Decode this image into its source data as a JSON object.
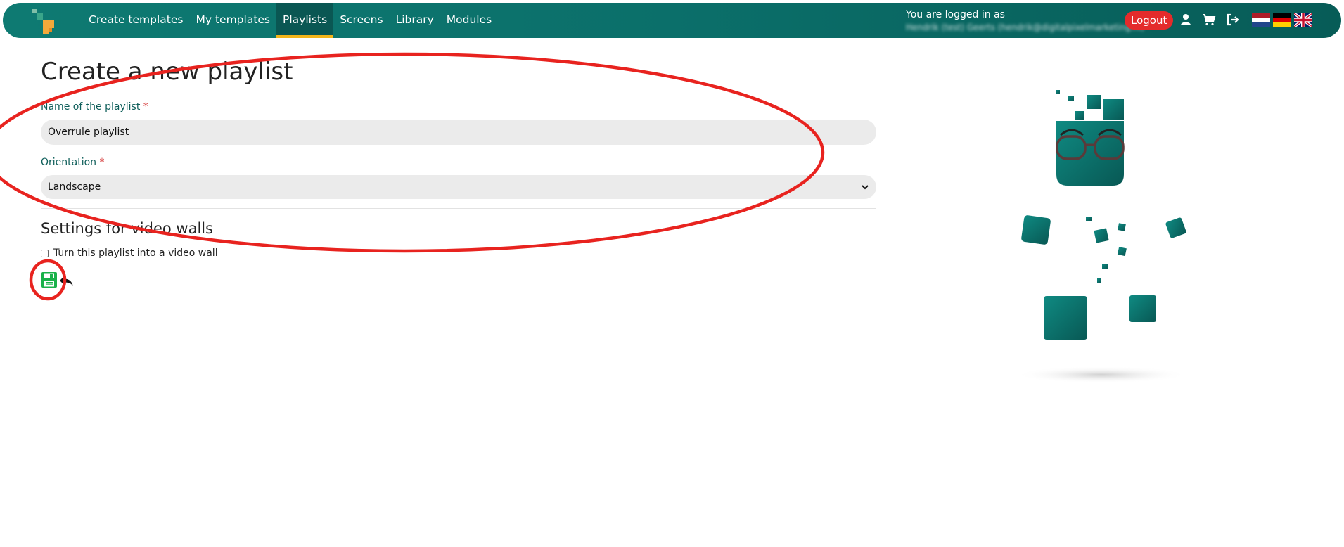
{
  "nav": {
    "logo_name": "app-logo",
    "links": [
      {
        "label": "Create templates"
      },
      {
        "label": "My templates"
      },
      {
        "label": "Playlists",
        "active": true
      },
      {
        "label": "Screens"
      },
      {
        "label": "Library"
      },
      {
        "label": "Modules"
      }
    ],
    "login_label": "You are logged in as",
    "login_email": "Hendrik (test) Geerts (hendrik@digitalpixelmarketing.nl)",
    "logout_label": "Logout",
    "icons": [
      "user-icon",
      "cart-icon",
      "sign-out-icon"
    ],
    "flags": [
      "flag-nl-icon",
      "flag-de-icon",
      "flag-uk-icon"
    ],
    "active_indicator_color": "#f3b51a",
    "brand_color": "#0e7a72"
  },
  "form": {
    "title": "Create a new playlist",
    "name_label": "Name of the playlist",
    "name_value": "Overrule playlist",
    "required_marker": "*",
    "orientation_label": "Orientation",
    "orientation_value": "Landscape",
    "video_wall_title": "Settings for video walls",
    "video_wall_checkbox_label": "Turn this playlist into a video wall",
    "video_wall_checked": false,
    "save_icon": "floppy-disk-icon",
    "back_icon": "undo-arrow-icon"
  },
  "annotations": {
    "color": "#e8231f",
    "shapes": [
      "ellipse-around-form",
      "circle-around-save-button"
    ]
  },
  "illustration": {
    "name": "pixel-character-illustration"
  }
}
